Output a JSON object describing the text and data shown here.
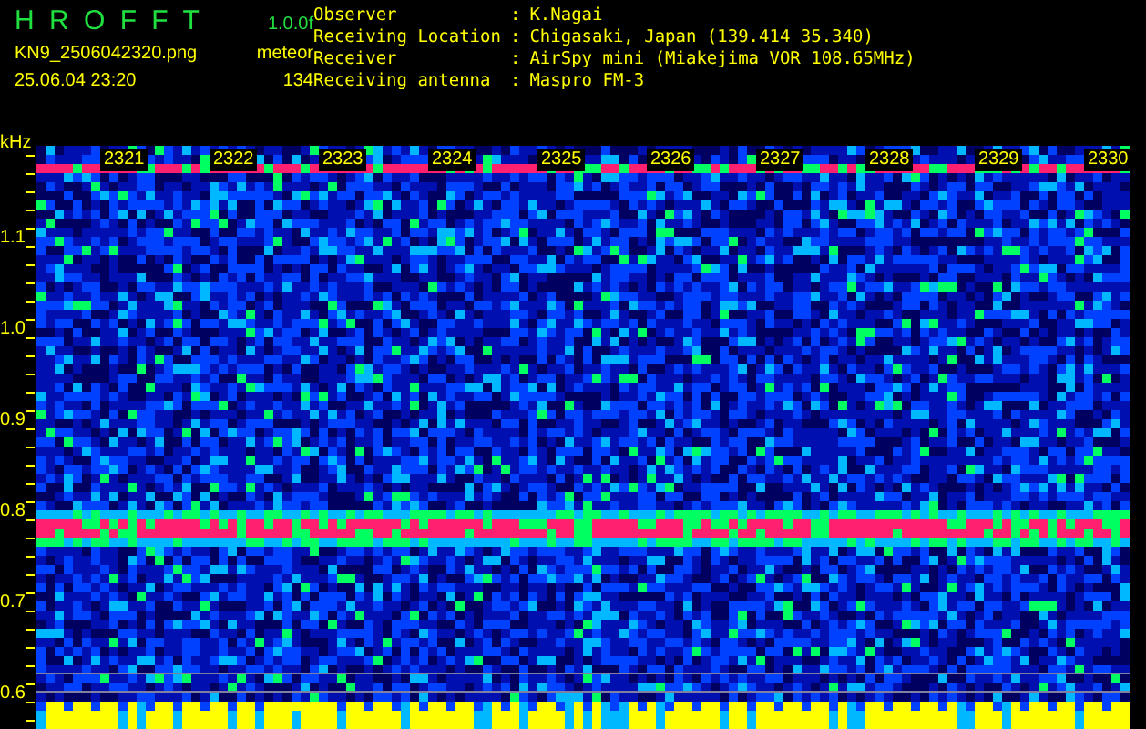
{
  "header": {
    "app_name": "H R O F F T",
    "version": "1.0.0f",
    "file_name": "KN9_2506042320.png",
    "mode": "meteor",
    "timestamp": "25.06.04 23:20",
    "count": "134"
  },
  "station_info": [
    {
      "label": "Observer",
      "separator": ":",
      "value": "K.Nagai"
    },
    {
      "label": "Receiving Location",
      "separator": ":",
      "value": "Chigasaki, Japan (139.414 35.340)"
    },
    {
      "label": "Receiver",
      "separator": ":",
      "value": "AirSpy mini (Miakejima VOR 108.65MHz)"
    },
    {
      "label": "Receiving antenna",
      "separator": ":",
      "value": "Maspro FM-3"
    }
  ],
  "y_axis": {
    "unit": "kHz",
    "labels": [
      "1.1",
      "1.0",
      "0.9",
      "0.8",
      "0.7",
      "0.6"
    ]
  },
  "time_labels": [
    "2321",
    "2322",
    "2323",
    "2324",
    "2325",
    "2326",
    "2327",
    "2328",
    "2329",
    "2330"
  ]
}
